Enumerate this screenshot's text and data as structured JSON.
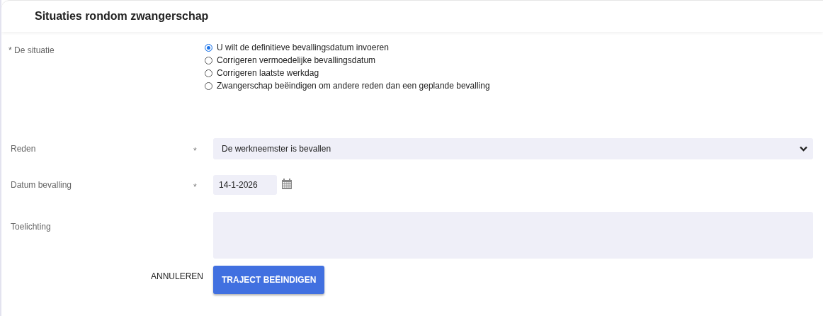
{
  "header": {
    "title": "Situaties rondom zwangerschap"
  },
  "situation": {
    "label": "* De situatie",
    "options": [
      {
        "label": "U wilt de definitieve bevallingsdatum invoeren",
        "selected": true
      },
      {
        "label": "Corrigeren vermoedelijke bevallingsdatum",
        "selected": false
      },
      {
        "label": "Corrigeren laatste werkdag",
        "selected": false
      },
      {
        "label": "Zwangerschap beëindigen om andere reden dan een geplande bevalling",
        "selected": false
      }
    ]
  },
  "fields": [
    {
      "kind": "select",
      "label": "Reden",
      "required_mark": "*",
      "value": "De werkneemster is bevallen"
    },
    {
      "kind": "date",
      "label": "Datum bevalling",
      "required_mark": "*",
      "value": "14-1-2026"
    },
    {
      "kind": "textarea",
      "label": "Toelichting"
    }
  ],
  "buttons": [
    {
      "kind": "text",
      "label": "ANNULEREN"
    },
    {
      "kind": "primary",
      "label": "TRAJECT BEËINDIGEN"
    }
  ]
}
